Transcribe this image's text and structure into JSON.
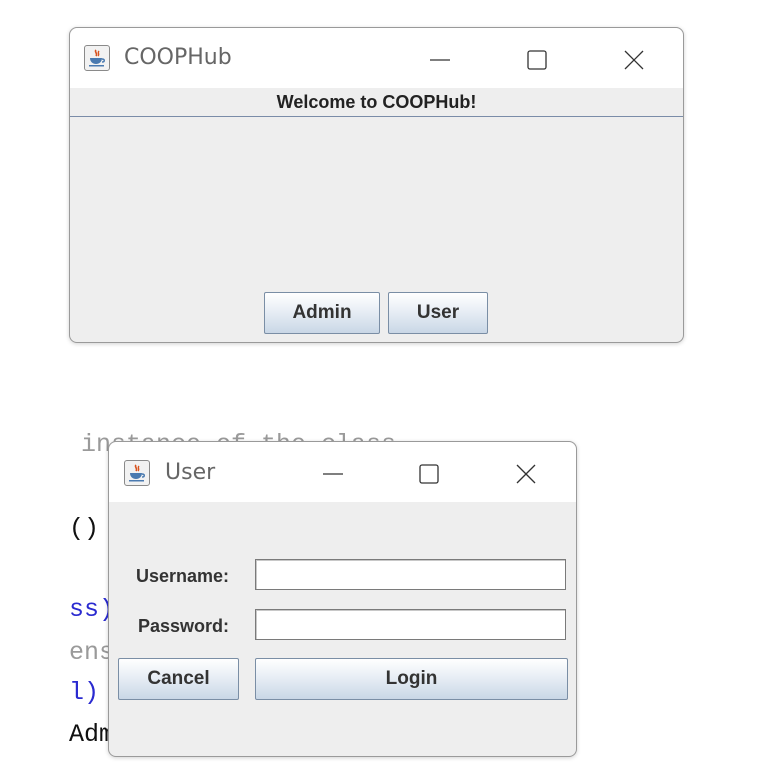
{
  "main_window": {
    "title": "COOPHub",
    "heading": "Welcome to COOPHub!",
    "buttons": {
      "admin": "Admin",
      "user": "User"
    }
  },
  "background_code": {
    "lines": [
      {
        "text": "instance of the class",
        "color": "#9a9a9a"
      },
      {
        "text": "()",
        "color": "#111111"
      },
      {
        "text": "ss)",
        "color": "#2a2ad0"
      },
      {
        "text": "ens",
        "color": "#9a9a9a"
      },
      {
        "text": "l)",
        "color": "#2a2ad0"
      },
      {
        "text": "Adm",
        "color": "#111111"
      }
    ]
  },
  "login_dialog": {
    "title": "User",
    "username_label": "Username:",
    "username_value": "",
    "password_label": "Password:",
    "password_value": "",
    "buttons": {
      "cancel": "Cancel",
      "login": "Login"
    }
  },
  "colors": {
    "window_bg": "#eeeeee",
    "titlebar_bg": "#ffffff",
    "heading_rule": "#7a8ca8",
    "button_border": "#7a8ea5"
  },
  "icons": {
    "app": "java-coffee-cup-icon",
    "minimize": "minimize-icon",
    "maximize": "maximize-icon",
    "close": "close-icon"
  }
}
